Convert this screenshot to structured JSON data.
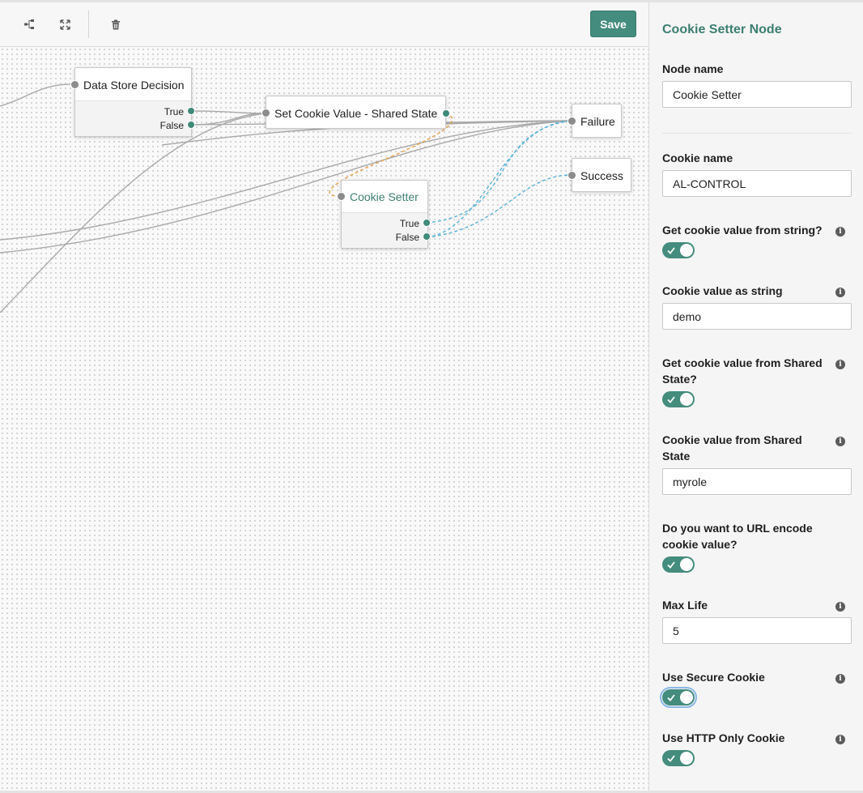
{
  "toolbar": {
    "layout_icon": "layout-icon",
    "fullscreen_icon": "expand-icon",
    "delete_icon": "trash-icon",
    "save_label": "Save"
  },
  "canvas": {
    "nodes": {
      "data_store_decision": {
        "title": "Data Store Decision",
        "outcome_true": "True",
        "outcome_false": "False"
      },
      "set_cookie_value": {
        "title": "Set Cookie Value - Shared State"
      },
      "failure": {
        "title": "Failure"
      },
      "success": {
        "title": "Success"
      },
      "cookie_setter": {
        "title": "Cookie Setter",
        "outcome_true": "True",
        "outcome_false": "False"
      }
    },
    "colors": {
      "accent": "#448c7d",
      "link": "#a9a9a9",
      "selected_link": "#5ab4d6",
      "loop_link": "#e8a24a"
    }
  },
  "panel": {
    "title": "Cookie Setter Node",
    "node_name_label": "Node name",
    "node_name_value": "Cookie Setter",
    "cookie_name_label": "Cookie name",
    "cookie_name_value": "AL-CONTROL",
    "from_string_label": "Get cookie value from string?",
    "from_string_on": true,
    "value_string_label": "Cookie value as string",
    "value_string_value": "demo",
    "from_shared_label": "Get cookie value from Shared State?",
    "from_shared_on": true,
    "value_shared_label": "Cookie value from Shared State",
    "value_shared_value": "myrole",
    "url_encode_label": "Do you want to URL encode cookie value?",
    "url_encode_on": true,
    "max_life_label": "Max Life",
    "max_life_value": "5",
    "secure_label": "Use Secure Cookie",
    "secure_on": true,
    "http_only_label": "Use HTTP Only Cookie",
    "http_only_on": true,
    "info_icon": "info-icon",
    "info_glyph": "i"
  }
}
